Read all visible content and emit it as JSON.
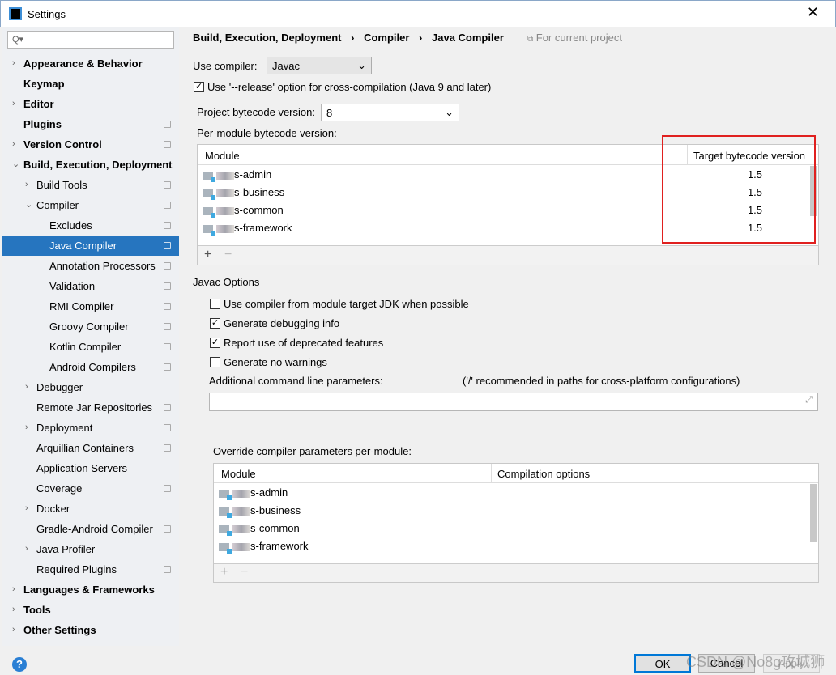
{
  "window": {
    "title": "Settings",
    "close_icon": "close-icon"
  },
  "search": {
    "placeholder": "Q▾"
  },
  "sidebar": {
    "items": [
      {
        "label": "Appearance & Behavior",
        "level": 0,
        "arrow": "›",
        "bold": true
      },
      {
        "label": "Keymap",
        "level": 0,
        "bold": true
      },
      {
        "label": "Editor",
        "level": 0,
        "arrow": "›",
        "bold": true
      },
      {
        "label": "Plugins",
        "level": 0,
        "bold": true,
        "project": true
      },
      {
        "label": "Version Control",
        "level": 0,
        "arrow": "›",
        "bold": true,
        "project": true
      },
      {
        "label": "Build, Execution, Deployment",
        "level": 0,
        "arrow": "⌄",
        "bold": true
      },
      {
        "label": "Build Tools",
        "level": 1,
        "arrow": "›",
        "project": true
      },
      {
        "label": "Compiler",
        "level": 1,
        "arrow": "⌄",
        "project": true
      },
      {
        "label": "Excludes",
        "level": 2,
        "project": true
      },
      {
        "label": "Java Compiler",
        "level": 2,
        "project": true,
        "selected": true
      },
      {
        "label": "Annotation Processors",
        "level": 2,
        "project": true
      },
      {
        "label": "Validation",
        "level": 2,
        "project": true
      },
      {
        "label": "RMI Compiler",
        "level": 2,
        "project": true
      },
      {
        "label": "Groovy Compiler",
        "level": 2,
        "project": true
      },
      {
        "label": "Kotlin Compiler",
        "level": 2,
        "project": true
      },
      {
        "label": "Android Compilers",
        "level": 2,
        "project": true
      },
      {
        "label": "Debugger",
        "level": 1,
        "arrow": "›"
      },
      {
        "label": "Remote Jar Repositories",
        "level": 1,
        "project": true
      },
      {
        "label": "Deployment",
        "level": 1,
        "arrow": "›",
        "project": true
      },
      {
        "label": "Arquillian Containers",
        "level": 1,
        "project": true
      },
      {
        "label": "Application Servers",
        "level": 1
      },
      {
        "label": "Coverage",
        "level": 1,
        "project": true
      },
      {
        "label": "Docker",
        "level": 1,
        "arrow": "›"
      },
      {
        "label": "Gradle-Android Compiler",
        "level": 1,
        "project": true
      },
      {
        "label": "Java Profiler",
        "level": 1,
        "arrow": "›"
      },
      {
        "label": "Required Plugins",
        "level": 1,
        "project": true
      },
      {
        "label": "Languages & Frameworks",
        "level": 0,
        "arrow": "›",
        "bold": true
      },
      {
        "label": "Tools",
        "level": 0,
        "arrow": "›",
        "bold": true
      },
      {
        "label": "Other Settings",
        "level": 0,
        "arrow": "›",
        "bold": true
      }
    ]
  },
  "breadcrumb": {
    "items": [
      "Build, Execution, Deployment",
      "Compiler",
      "Java Compiler"
    ],
    "sep": "›",
    "scope": "For current project"
  },
  "use_compiler": {
    "label": "Use compiler:",
    "value": "Javac"
  },
  "release_option": {
    "label": "Use '--release' option for cross-compilation (Java 9 and later)",
    "checked": true
  },
  "bytecode": {
    "label": "Project bytecode version:",
    "value": "8"
  },
  "per_module": {
    "label": "Per-module bytecode version:",
    "headers": [
      "Module",
      "Target bytecode version"
    ],
    "rows": [
      {
        "module": "s-admin",
        "version": "1.5"
      },
      {
        "module": "s-business",
        "version": "1.5"
      },
      {
        "module": "s-common",
        "version": "1.5"
      },
      {
        "module": "s-framework",
        "version": "1.5"
      }
    ]
  },
  "javac": {
    "title": "Javac Options",
    "options": [
      {
        "label": "Use compiler from module target JDK when possible",
        "checked": false
      },
      {
        "label": "Generate debugging info",
        "checked": true
      },
      {
        "label": "Report use of deprecated features",
        "checked": true
      },
      {
        "label": "Generate no warnings",
        "checked": false
      }
    ],
    "params_label": "Additional command line parameters:",
    "params_hint": "('/' recommended in paths for cross-platform configurations)",
    "params_value": ""
  },
  "override": {
    "label": "Override compiler parameters per-module:",
    "headers": [
      "Module",
      "Compilation options"
    ],
    "rows": [
      {
        "module": "s-admin",
        "options": ""
      },
      {
        "module": "s-business",
        "options": ""
      },
      {
        "module": "s-common",
        "options": ""
      },
      {
        "module": "s-framework",
        "options": ""
      }
    ]
  },
  "toolbar": {
    "add": "+",
    "remove": "−"
  },
  "buttons": {
    "ok": "OK",
    "cancel": "Cancel",
    "apply": "Apply",
    "help": "?"
  },
  "watermark": "CSDN @No8g攻城狮",
  "colors": {
    "selection": "#2675bf",
    "highlight_box": "#e0201f"
  }
}
